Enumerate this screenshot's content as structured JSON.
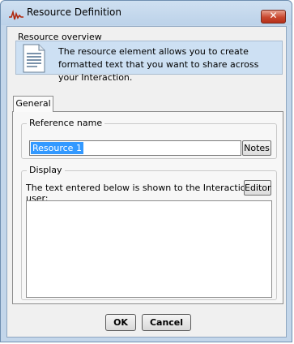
{
  "window": {
    "title": "Resource Definition",
    "close_symbol": "✕",
    "accent_color": "#c3d6ea",
    "close_color": "#c9482f"
  },
  "overview": {
    "label": "Resource overview",
    "icon": "document-icon",
    "text": "The resource element allows you to create formatted text that you want to share across your Interaction."
  },
  "tabs": [
    {
      "label": "General",
      "selected": true
    }
  ],
  "reference": {
    "label": "Reference name",
    "value": "Resource 1",
    "notes_button": "Notes"
  },
  "display": {
    "label": "Display",
    "description": "The text entered below is shown to the Interaction user:",
    "editor_button": "Editor",
    "content": ""
  },
  "footer": {
    "ok_label": "OK",
    "cancel_label": "Cancel"
  }
}
